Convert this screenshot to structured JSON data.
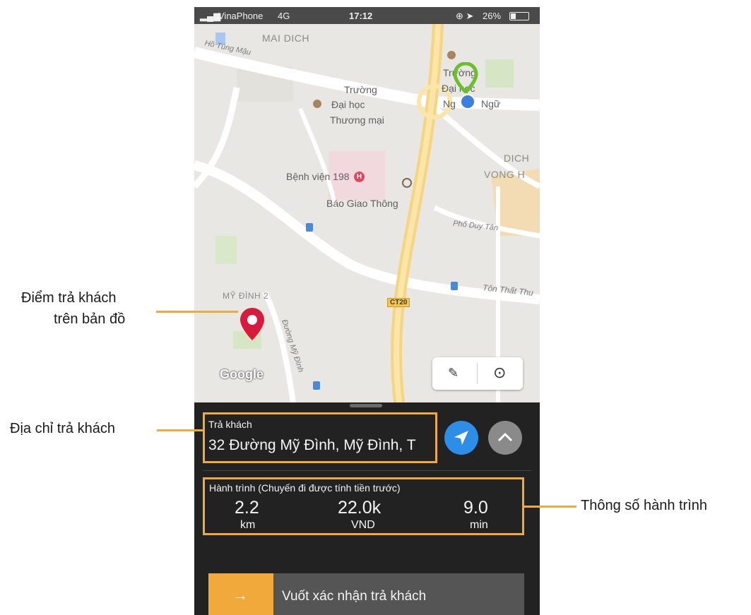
{
  "status_bar": {
    "carrier": "VinaPhone",
    "network": "4G",
    "time": "17:12",
    "battery": "26%"
  },
  "map": {
    "labels": {
      "area_mai_dich": "MAI DICH",
      "area_dich_vong_1": "DICH",
      "area_dich_vong_2": "VONG H",
      "area_my_dinh_2": "MỸ ĐÌNH 2",
      "street_tung_mau": "Hồ Tùng Mậu",
      "street_duy_tan": "Phố Duy Tân",
      "street_ton_that_thuyet": "Tôn Thất Thu",
      "street_my_dinh": "Đường Mỹ Đình",
      "poi_thuongmai_1": "Trường",
      "poi_thuongmai_2": "Đại học",
      "poi_thuongmai_3": "Thương mại",
      "poi_ngoaingu_1": "Trường",
      "poi_ngoaingu_2": "Đại học",
      "poi_ngoaingu_3": "Ng",
      "poi_ngoaingu_4": "Ngữ",
      "poi_hospital": "Bệnh viện 198",
      "poi_newspaper": "Báo Giao Thông",
      "route_badge": "CT20",
      "google_logo": "Google"
    },
    "icons": {
      "pickup_marker": "green-pin-icon",
      "current_location": "blue-dot-icon",
      "dropoff_marker": "red-pin-icon",
      "hospital": "hospital-icon",
      "pin_map": "map-pin-icon",
      "locate": "crosshair-icon"
    }
  },
  "dropoff": {
    "label": "Trả khách",
    "address": "32 Đường Mỹ Đình, Mỹ Đình, T"
  },
  "trip": {
    "header": "Hành trình (Chuyến đi được tính tiền trước)",
    "distance_value": "2.2",
    "distance_unit": "km",
    "fare_value": "22.0k",
    "fare_unit": "VND",
    "time_value": "9.0",
    "time_unit": "min"
  },
  "slider": {
    "label": "Vuốt xác nhận trả khách",
    "arrow": "→"
  },
  "annotations": {
    "dropoff_point_line1": "Điểm trả khách",
    "dropoff_point_line2": "trên bản đồ",
    "dropoff_address": "Địa chỉ trả khách",
    "trip_params": "Thông số hành trình"
  },
  "colors": {
    "accent": "#f0a93a",
    "panel_bg": "#222222",
    "nav_blue": "#2d8ee8",
    "pin_red": "#d81b3c",
    "pin_green": "#6bbf2a"
  }
}
